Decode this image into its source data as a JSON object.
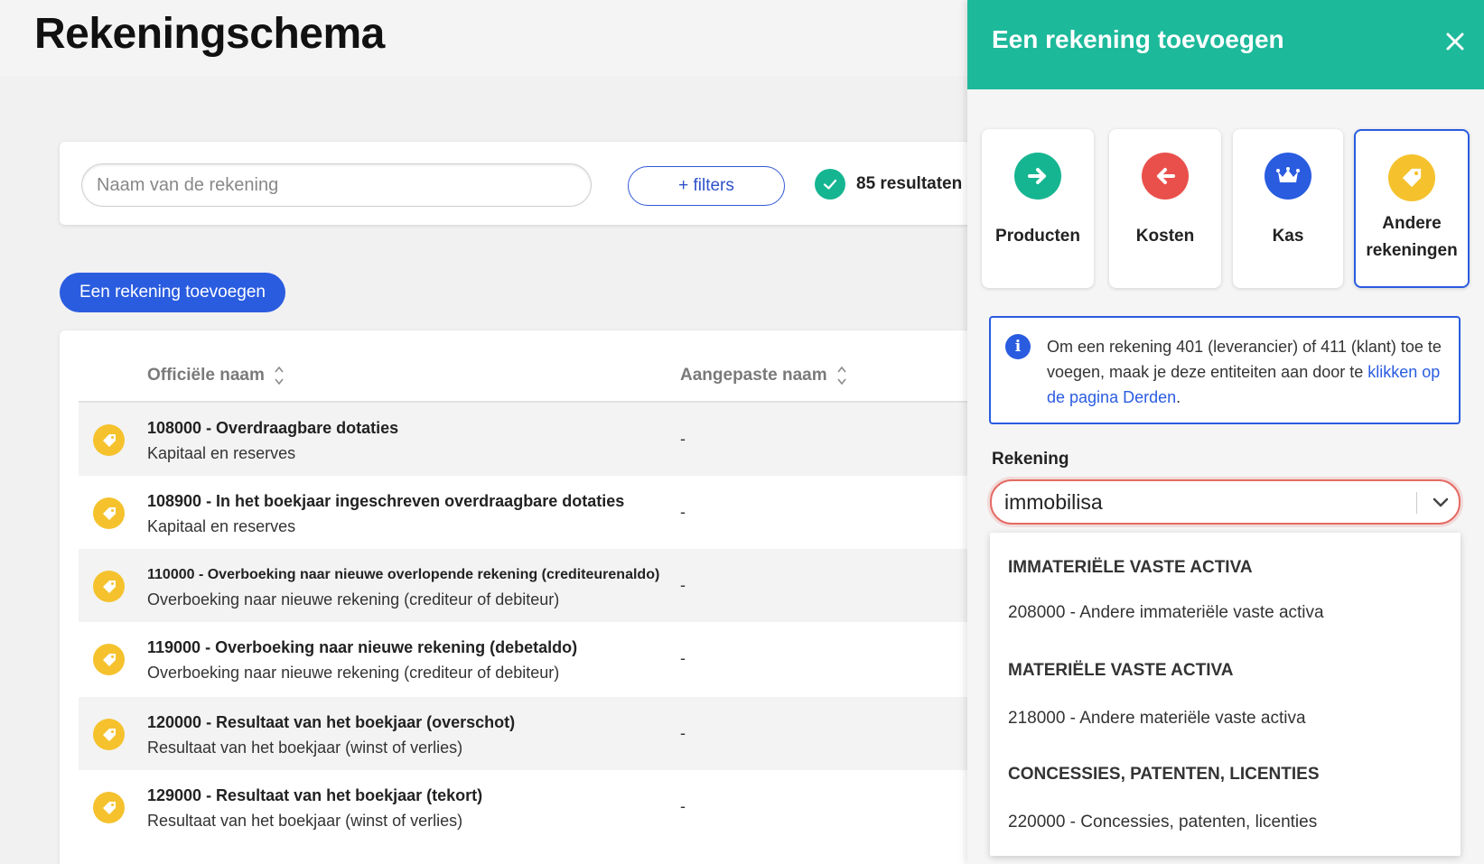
{
  "page": {
    "title": "Rekeningschema"
  },
  "search": {
    "placeholder": "Naam van de rekening",
    "filters_label": "+ filters",
    "results_label": "85 resultaten"
  },
  "add_button": {
    "label": "Een rekening toevoegen"
  },
  "table": {
    "headers": {
      "official_name": "Officiële naam",
      "custom_name": "Aangepaste naam"
    },
    "rows": [
      {
        "title": "108000 - Overdraagbare dotaties",
        "subtitle": "Kapitaal en reserves",
        "custom": "-"
      },
      {
        "title": "108900 - In het boekjaar ingeschreven overdraagbare dotaties",
        "subtitle": "Kapitaal en reserves",
        "custom": "-"
      },
      {
        "title": "110000 - Overboeking naar nieuwe overlopende rekening (crediteurenaldo)",
        "subtitle": "Overboeking naar nieuwe rekening (crediteur of debiteur)",
        "custom": "-"
      },
      {
        "title": "119000 - Overboeking naar nieuwe rekening (debetaldo)",
        "subtitle": "Overboeking naar nieuwe rekening (crediteur of debiteur)",
        "custom": "-"
      },
      {
        "title": "120000 - Resultaat van het boekjaar (overschot)",
        "subtitle": "Resultaat van het boekjaar (winst of verlies)",
        "custom": "-"
      },
      {
        "title": "129000 - Resultaat van het boekjaar (tekort)",
        "subtitle": "Resultaat van het boekjaar (winst of verlies)",
        "custom": "-"
      }
    ]
  },
  "panel": {
    "title": "Een rekening toevoegen",
    "types": [
      {
        "label": "Producten",
        "icon": "arrow-right-icon",
        "color": "#16b591"
      },
      {
        "label": "Kosten",
        "icon": "arrow-left-icon",
        "color": "#e9504b"
      },
      {
        "label": "Kas",
        "icon": "crown-icon",
        "color": "#2a5ce0"
      },
      {
        "label_line1": "Andere",
        "label_line2": "rekeningen",
        "icon": "tag-icon",
        "color": "#f5c22d"
      }
    ],
    "info": {
      "text": "Om een rekening 401 (leverancier) of 411 (klant) toe te voegen, maak je deze entiteiten aan door te ",
      "link": "klikken op de pagina Derden",
      "end": "."
    },
    "field_label": "Rekening",
    "field_value": "immobilisa",
    "dropdown": [
      {
        "group": "IMMATERIËLE VASTE ACTIVA",
        "option": "208000 - Andere immateriële vaste activa"
      },
      {
        "group": "MATERIËLE VASTE ACTIVA",
        "option": "218000 - Andere materiële vaste activa"
      },
      {
        "group": "CONCESSIES, PATENTEN, LICENTIES",
        "option": "220000 - Concessies, patenten, licenties"
      }
    ]
  },
  "colors": {
    "accent": "#1db99b",
    "primary": "#2a5ce0",
    "tag": "#f5c22d",
    "error": "#e46b64"
  }
}
